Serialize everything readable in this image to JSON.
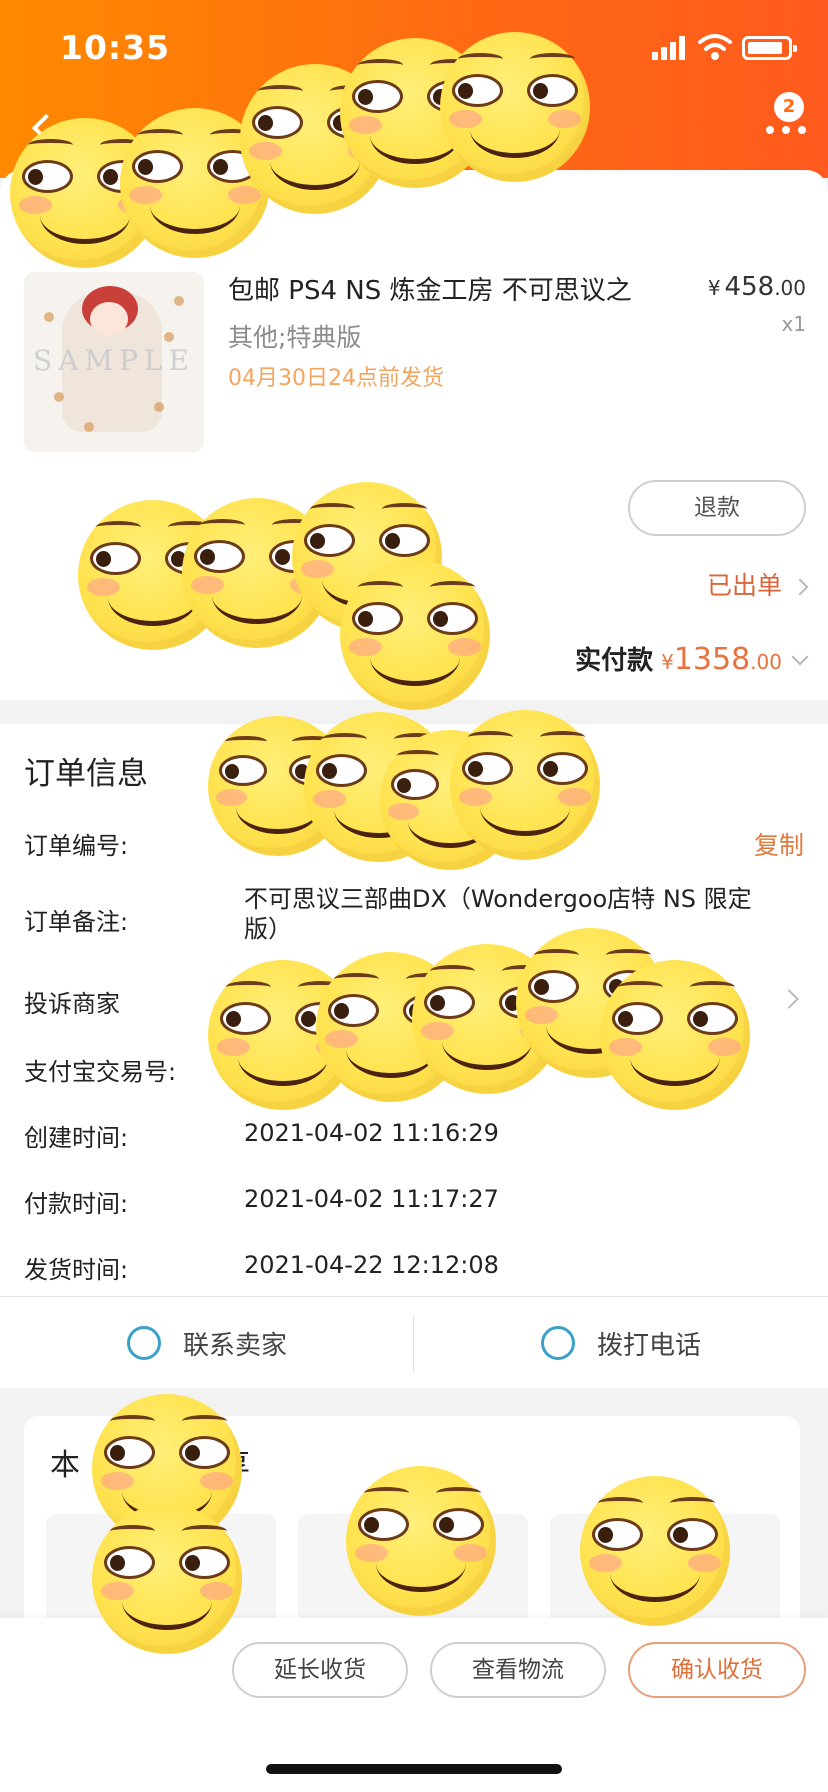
{
  "status_bar": {
    "time": "10:35"
  },
  "header": {
    "more_badge": "2"
  },
  "order": {
    "product": {
      "title": "包邮 PS4 NS 炼金工房 不可思议之",
      "price_currency": "¥",
      "price_int": "458",
      "price_dec": ".00",
      "quantity": "x1",
      "spec": "其他;特典版",
      "ship_note": "04月30日24点前发货",
      "thumb_watermark": "SAMPLE"
    },
    "refund_button": "退款",
    "status": "已出单",
    "total_label": "实付款",
    "total_currency": "¥",
    "total_int": "1358",
    "total_dec": ".00"
  },
  "order_info": {
    "title": "订单信息",
    "copy_label": "复制",
    "rows": [
      {
        "label": "订单编号:",
        "value": ""
      },
      {
        "label": "订单备注:",
        "value": "不可思议三部曲DX（Wondergoo店特 NS 限定版）"
      },
      {
        "label": "投诉商家",
        "value": ""
      },
      {
        "label": "支付宝交易号:",
        "value": ""
      },
      {
        "label": "创建时间:",
        "value": "2021-04-02 11:16:29"
      },
      {
        "label": "付款时间:",
        "value": "2021-04-02 11:17:27"
      },
      {
        "label": "发货时间:",
        "value": "2021-04-22 12:12:08"
      }
    ]
  },
  "contact": {
    "seller_label": "联系卖家",
    "call_label": "拨打电话"
  },
  "recommend": {
    "title_visible": "本",
    "title_tail": "享"
  },
  "bottom_bar": {
    "extend_label": "延长收货",
    "logistics_label": "查看物流",
    "confirm_label": "确认收货"
  },
  "colors": {
    "header_start": "#ff8a00",
    "header_end": "#ff5a1e",
    "accent_orange": "#e0703a",
    "ship_note": "#f2a55f"
  }
}
